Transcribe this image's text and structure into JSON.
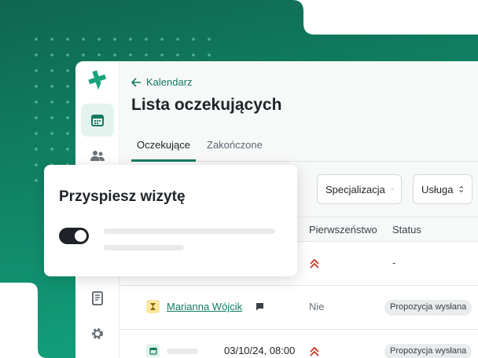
{
  "colors": {
    "brand": "#137a60",
    "brand_dark": "#0e5c48",
    "sidebar_active": "#e4f3ee",
    "priority": "#c0392b"
  },
  "icons": {
    "logo": "medical-cross-logo",
    "sidebar": [
      "calendar-icon",
      "users-icon",
      "book-icon",
      "gear-icon"
    ]
  },
  "header": {
    "back_label": "Kalendarz",
    "title": "Lista oczekujących"
  },
  "tabs": [
    {
      "label": "Oczekujące",
      "active": true
    },
    {
      "label": "Zakończone",
      "active": false
    }
  ],
  "filters": [
    {
      "label": "Specjalizacja"
    },
    {
      "label": "Usługa"
    }
  ],
  "table": {
    "columns": [
      "Pierwszeństwo",
      "Status"
    ],
    "rows": [
      {
        "patient": "",
        "date": "",
        "priority": "high",
        "status": "-"
      },
      {
        "patient": "Marianna Wójcik",
        "date": "",
        "priority": "Nie",
        "status": "Propozycja wysłana"
      },
      {
        "patient": "",
        "date": "03/10/24, 08:00",
        "priority": "high",
        "status": "Propozycja wysłana"
      }
    ]
  },
  "card": {
    "title": "Przyspiesz wizytę",
    "toggle_on": true
  }
}
